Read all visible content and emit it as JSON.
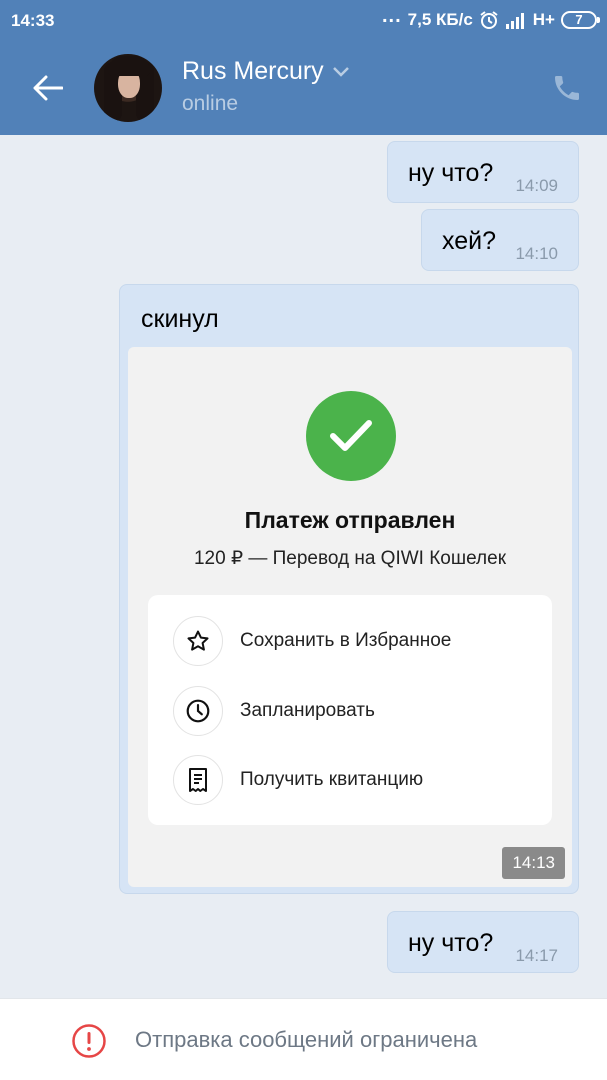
{
  "status_bar": {
    "time": "14:33",
    "dots": "...",
    "speed": "7,5 КБ/с",
    "network": "H+",
    "battery": "7"
  },
  "header": {
    "contact_name": "Rus Mercury",
    "contact_status": "online"
  },
  "messages": [
    {
      "text": "ну что?",
      "time": "14:09"
    },
    {
      "text": "хей?",
      "time": "14:10"
    },
    {
      "text": "скинул",
      "time": "14:13"
    },
    {
      "text": "ну что?",
      "time": "14:17"
    }
  ],
  "payment": {
    "title": "Платеж отправлен",
    "subtitle": "120 ₽ — Перевод на QIWI Кошелек",
    "actions": [
      {
        "label": "Сохранить в Избранное",
        "icon": "star-icon"
      },
      {
        "label": "Запланировать",
        "icon": "clock-icon"
      },
      {
        "label": "Получить квитанцию",
        "icon": "receipt-icon"
      }
    ]
  },
  "footer": {
    "notice": "Отправка сообщений ограничена"
  },
  "colors": {
    "header_bg": "#5181b8",
    "bubble_bg": "#d6e4f5",
    "success_green": "#4bb34b",
    "warning_red": "#e64646"
  }
}
